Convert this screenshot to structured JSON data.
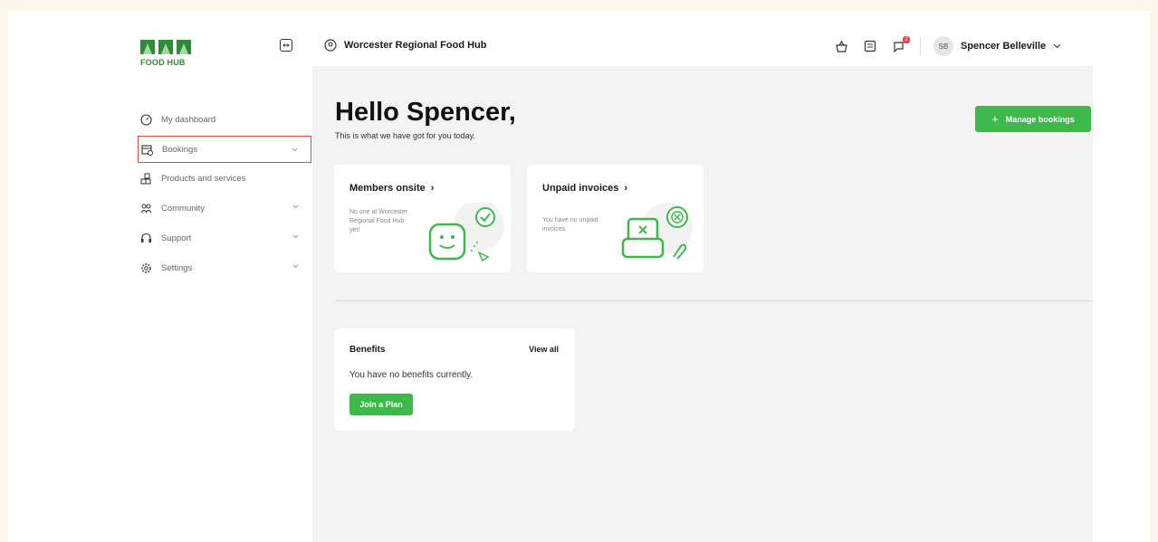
{
  "brand": {
    "logo_text": "FOOD HUB",
    "accent": "#3db94c"
  },
  "topbar": {
    "location": "Worcester Regional Food Hub",
    "notification_count": "1",
    "user": {
      "initials": "SB",
      "name": "Spencer Belleville"
    }
  },
  "sidebar": {
    "items": [
      {
        "label": "My dashboard",
        "icon": "dashboard-icon"
      },
      {
        "label": "Bookings",
        "icon": "bookings-icon",
        "active": true
      },
      {
        "label": "Products and services",
        "icon": "products-icon"
      },
      {
        "label": "Community",
        "icon": "community-icon"
      },
      {
        "label": "Support",
        "icon": "support-icon"
      },
      {
        "label": "Settings",
        "icon": "settings-icon"
      }
    ]
  },
  "main": {
    "greeting": "Hello Spencer,",
    "subtitle": "This is what we have got for you today.",
    "manage_label": "Manage bookings",
    "members_card": {
      "title": "Members onsite",
      "text": "No one at Worcester Regional Food Hub yet!"
    },
    "invoices_card": {
      "title": "Unpaid invoices",
      "text": "You have no unpaid invoices."
    },
    "benefits_card": {
      "title": "Benefits",
      "view_all": "View all",
      "text": "You have no benefits currently.",
      "join_label": "Join a Plan"
    }
  }
}
